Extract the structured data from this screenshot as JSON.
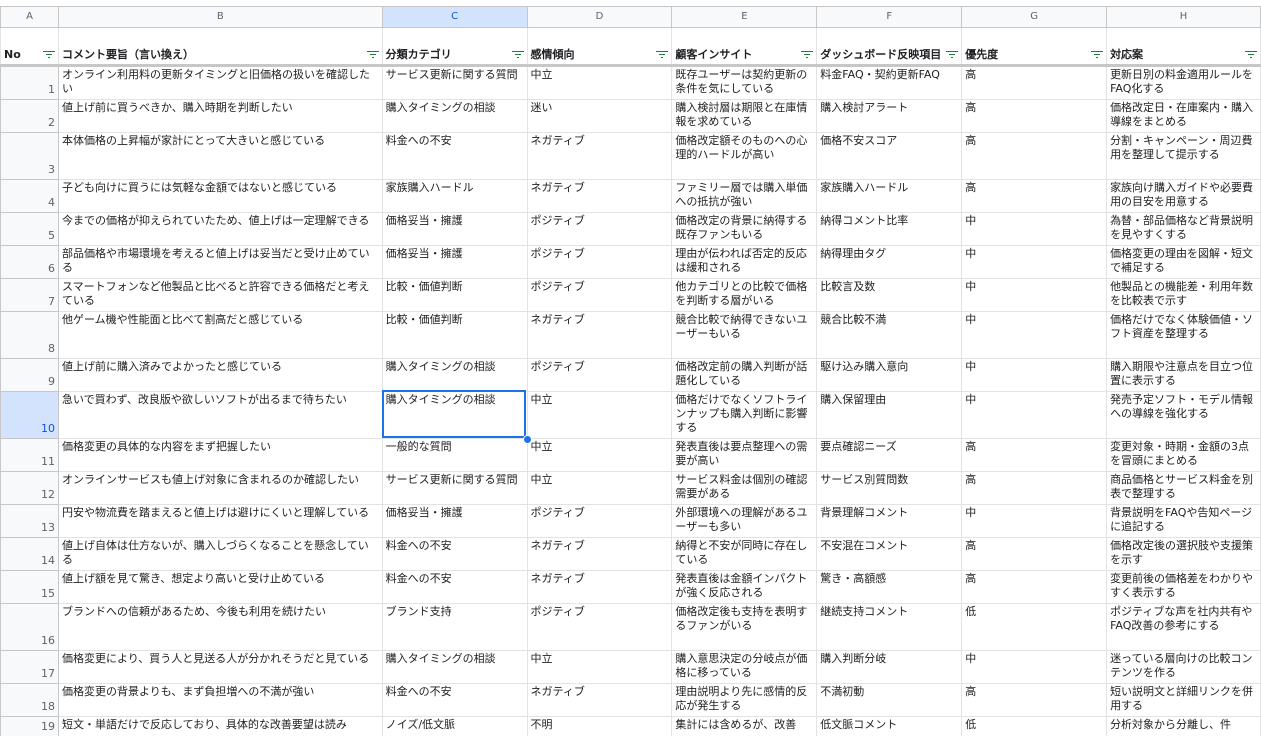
{
  "columns": [
    "A",
    "B",
    "C",
    "D",
    "E",
    "F",
    "G",
    "H"
  ],
  "selected_column": "C",
  "headers": [
    "No",
    "コメント要旨（言い換え）",
    "分類カテゴリ",
    "感情傾向",
    "顧客インサイト",
    "ダッシュボード反映項目",
    "優先度",
    "対応案"
  ],
  "rows": [
    {
      "no": "1",
      "summary": "オンライン利用料の更新タイミングと旧価格の扱いを確認したい",
      "category": "サービス更新に関する質問",
      "sentiment": "中立",
      "insight": "既存ユーザーは契約更新の条件を気にしている",
      "dashboard": "料金FAQ・契約更新FAQ",
      "priority": "高",
      "action": "更新日別の料金適用ルールをFAQ化する"
    },
    {
      "no": "2",
      "summary": "値上げ前に買うべきか、購入時期を判断したい",
      "category": "購入タイミングの相談",
      "sentiment": "迷い",
      "insight": "購入検討層は期限と在庫情報を求めている",
      "dashboard": "購入検討アラート",
      "priority": "高",
      "action": "価格改定日・在庫案内・購入導線をまとめる"
    },
    {
      "no": "3",
      "summary": "本体価格の上昇幅が家計にとって大きいと感じている",
      "category": "料金への不安",
      "sentiment": "ネガティブ",
      "insight": "価格改定額そのものへの心理的ハードルが高い",
      "dashboard": "価格不安スコア",
      "priority": "高",
      "action": "分割・キャンペーン・周辺費用を整理して提示する"
    },
    {
      "no": "4",
      "summary": "子ども向けに買うには気軽な金額ではないと感じている",
      "category": "家族購入ハードル",
      "sentiment": "ネガティブ",
      "insight": "ファミリー層では購入単価への抵抗が強い",
      "dashboard": "家族購入ハードル",
      "priority": "高",
      "action": "家族向け購入ガイドや必要費用の目安を用意する"
    },
    {
      "no": "5",
      "summary": "今までの価格が抑えられていたため、値上げは一定理解できる",
      "category": "価格妥当・擁護",
      "sentiment": "ポジティブ",
      "insight": "価格改定の背景に納得する既存ファンもいる",
      "dashboard": "納得コメント比率",
      "priority": "中",
      "action": "為替・部品価格など背景説明を見やすくする"
    },
    {
      "no": "6",
      "summary": "部品価格や市場環境を考えると値上げは妥当だと受け止めている",
      "category": "価格妥当・擁護",
      "sentiment": "ポジティブ",
      "insight": "理由が伝われば否定的反応は緩和される",
      "dashboard": "納得理由タグ",
      "priority": "中",
      "action": "価格変更の理由を図解・短文で補足する"
    },
    {
      "no": "7",
      "summary": "スマートフォンなど他製品と比べると許容できる価格だと考えている",
      "category": "比較・価値判断",
      "sentiment": "ポジティブ",
      "insight": "他カテゴリとの比較で価格を判断する層がいる",
      "dashboard": "比較言及数",
      "priority": "中",
      "action": "他製品との機能差・利用年数を比較表で示す"
    },
    {
      "no": "8",
      "summary": "他ゲーム機や性能面と比べて割高だと感じている",
      "category": "比較・価値判断",
      "sentiment": "ネガティブ",
      "insight": "競合比較で納得できないユーザーもいる",
      "dashboard": "競合比較不満",
      "priority": "中",
      "action": "価格だけでなく体験価値・ソフト資産を整理する"
    },
    {
      "no": "9",
      "summary": "値上げ前に購入済みでよかったと感じている",
      "category": "購入タイミングの相談",
      "sentiment": "ポジティブ",
      "insight": "価格改定前の購入判断が話題化している",
      "dashboard": "駆け込み購入意向",
      "priority": "中",
      "action": "購入期限や注意点を目立つ位置に表示する"
    },
    {
      "no": "10",
      "summary": "急いで買わず、改良版や欲しいソフトが出るまで待ちたい",
      "category": "購入タイミングの相談",
      "sentiment": "中立",
      "insight": "価格だけでなくソフトラインナップも購入判断に影響する",
      "dashboard": "購入保留理由",
      "priority": "中",
      "action": "発売予定ソフト・モデル情報への導線を強化する"
    },
    {
      "no": "11",
      "summary": "価格変更の具体的な内容をまず把握したい",
      "category": "一般的な質問",
      "sentiment": "中立",
      "insight": "発表直後は要点整理への需要が高い",
      "dashboard": "要点確認ニーズ",
      "priority": "高",
      "action": "変更対象・時期・金額の3点を冒頭にまとめる"
    },
    {
      "no": "12",
      "summary": "オンラインサービスも値上げ対象に含まれるのか確認したい",
      "category": "サービス更新に関する質問",
      "sentiment": "中立",
      "insight": "サービス料金は個別の確認需要がある",
      "dashboard": "サービス別質問数",
      "priority": "高",
      "action": "商品価格とサービス料金を別表で整理する"
    },
    {
      "no": "13",
      "summary": "円安や物流費を踏まえると値上げは避けにくいと理解している",
      "category": "価格妥当・擁護",
      "sentiment": "ポジティブ",
      "insight": "外部環境への理解があるユーザーも多い",
      "dashboard": "背景理解コメント",
      "priority": "中",
      "action": "背景説明をFAQや告知ページに追記する"
    },
    {
      "no": "14",
      "summary": "値上げ自体は仕方ないが、購入しづらくなることを懸念している",
      "category": "料金への不安",
      "sentiment": "ネガティブ",
      "insight": "納得と不安が同時に存在している",
      "dashboard": "不安混在コメント",
      "priority": "高",
      "action": "価格改定後の選択肢や支援策を示す"
    },
    {
      "no": "15",
      "summary": "値上げ額を見て驚き、想定より高いと受け止めている",
      "category": "料金への不安",
      "sentiment": "ネガティブ",
      "insight": "発表直後は金額インパクトが強く反応される",
      "dashboard": "驚き・高額感",
      "priority": "高",
      "action": "変更前後の価格差をわかりやすく表示する"
    },
    {
      "no": "16",
      "summary": "ブランドへの信頼があるため、今後も利用を続けたい",
      "category": "ブランド支持",
      "sentiment": "ポジティブ",
      "insight": "価格改定後も支持を表明するファンがいる",
      "dashboard": "継続支持コメント",
      "priority": "低",
      "action": "ポジティブな声を社内共有やFAQ改善の参考にする"
    },
    {
      "no": "17",
      "summary": "価格変更により、買う人と見送る人が分かれそうだと見ている",
      "category": "購入タイミングの相談",
      "sentiment": "中立",
      "insight": "購入意思決定の分岐点が価格に移っている",
      "dashboard": "購入判断分岐",
      "priority": "中",
      "action": "迷っている層向けの比較コンテンツを作る"
    },
    {
      "no": "18",
      "summary": "価格変更の背景よりも、まず負担増への不満が強い",
      "category": "料金への不安",
      "sentiment": "ネガティブ",
      "insight": "理由説明より先に感情的反応が発生する",
      "dashboard": "不満初動",
      "priority": "高",
      "action": "短い説明文と詳細リンクを併用する"
    },
    {
      "no": "19",
      "summary": "短文・単語だけで反応しており、具体的な改善要望は読み",
      "category": "ノイズ/低文脈",
      "sentiment": "不明",
      "insight": "集計には含めるが、改善",
      "dashboard": "低文脈コメント",
      "priority": "低",
      "action": "分析対象から分離し、件"
    }
  ]
}
